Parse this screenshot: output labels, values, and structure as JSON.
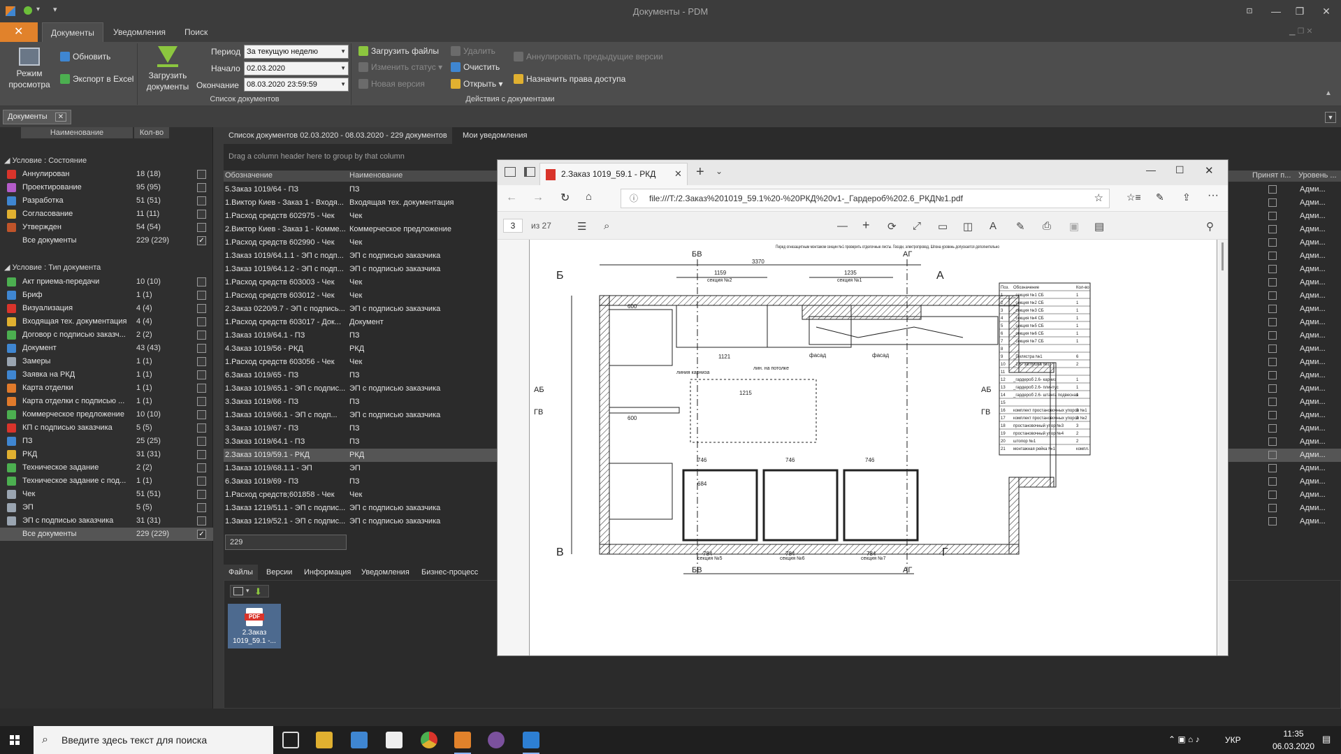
{
  "window": {
    "title": "Документы - PDM"
  },
  "ribbon": {
    "tabs": [
      "Документы",
      "Уведомления",
      "Поиск"
    ],
    "view_mode_label": "Режим просмотра",
    "refresh_label": "Обновить",
    "export_label": "Экспорт в Excel",
    "upload_docs_label": "Загрузить документы",
    "period_label": "Период",
    "period_value": "За текущую неделю",
    "start_label": "Начало",
    "start_value": "02.03.2020",
    "end_label": "Окончание",
    "end_value": "08.03.2020 23:59:59",
    "group_doclist": "Список документов",
    "upload_files": "Загрузить файлы",
    "change_status": "Изменить статус",
    "new_version": "Новая версия",
    "delete": "Удалить",
    "clear": "Очистить",
    "open": "Открыть",
    "annul_prev": "Аннулировать предыдущие версии",
    "assign_rights": "Назначить права доступа",
    "group_actions": "Действия с документами"
  },
  "doc_tab": {
    "label": "Документы"
  },
  "left": {
    "col_name": "Наименование",
    "col_count": "Кол-во",
    "group_state": "Условие : Состояние",
    "states": [
      {
        "name": "Аннулирован",
        "count": "18 (18)",
        "color": "#d9342b"
      },
      {
        "name": "Проектирование",
        "count": "95 (95)",
        "color": "#b45cc9"
      },
      {
        "name": "Разработка",
        "count": "51 (51)",
        "color": "#3f86d1"
      },
      {
        "name": "Согласование",
        "count": "11 (11)",
        "color": "#e0b030"
      },
      {
        "name": "Утвержден",
        "count": "54 (54)",
        "color": "#c0542a"
      },
      {
        "name": "Все документы",
        "count": "229 (229)",
        "color": ""
      }
    ],
    "group_type": "Условие : Тип документа",
    "types": [
      {
        "name": "Акт приема-передачи",
        "count": "10 (10)",
        "color": "#4caf50"
      },
      {
        "name": "Бриф",
        "count": "1 (1)",
        "color": "#3f86d1"
      },
      {
        "name": "Визуализация",
        "count": "4 (4)",
        "color": "#d9342b"
      },
      {
        "name": "Входящая тех. документация",
        "count": "4 (4)",
        "color": "#e0b030"
      },
      {
        "name": "Договор с подписью заказч...",
        "count": "2 (2)",
        "color": "#4caf50"
      },
      {
        "name": "Документ",
        "count": "43 (43)",
        "color": "#3f86d1"
      },
      {
        "name": "Замеры",
        "count": "1 (1)",
        "color": "#9aa5b1"
      },
      {
        "name": "Заявка на РКД",
        "count": "1 (1)",
        "color": "#3f86d1"
      },
      {
        "name": "Карта отделки",
        "count": "1 (1)",
        "color": "#e07a2b"
      },
      {
        "name": "Карта отделки с подписью ...",
        "count": "1 (1)",
        "color": "#e07a2b"
      },
      {
        "name": "Коммерческое предложение",
        "count": "10 (10)",
        "color": "#4caf50"
      },
      {
        "name": "КП с подписью заказчика",
        "count": "5 (5)",
        "color": "#d9342b"
      },
      {
        "name": "ПЗ",
        "count": "25 (25)",
        "color": "#3f86d1"
      },
      {
        "name": "РКД",
        "count": "31 (31)",
        "color": "#e0b030"
      },
      {
        "name": "Техническое задание",
        "count": "2 (2)",
        "color": "#4caf50"
      },
      {
        "name": "Техническое задание с под...",
        "count": "1 (1)",
        "color": "#4caf50"
      },
      {
        "name": "Чек",
        "count": "51 (51)",
        "color": "#9aa5b1"
      },
      {
        "name": "ЭП",
        "count": "5 (5)",
        "color": "#9aa5b1"
      },
      {
        "name": "ЭП с подписью заказчика",
        "count": "31 (31)",
        "color": "#9aa5b1"
      },
      {
        "name": "Все документы",
        "count": "229 (229)",
        "color": ""
      }
    ]
  },
  "center": {
    "tab_list": "Список документов 02.03.2020 - 08.03.2020 - 229 документов",
    "tab_notifications": "Мои уведомления",
    "drag_hint": "Drag a column header here to group by that column",
    "col_designation": "Обозначение",
    "col_name": "Наименование",
    "col_accepted": "Принят п...",
    "col_level": "Уровень ...",
    "admin": "Адми...",
    "rows": [
      [
        "5.Заказ 1019/64 - ПЗ",
        "ПЗ"
      ],
      [
        "1.Виктор Киев - Заказ 1 - Входя...",
        "Входящая тех. документация"
      ],
      [
        "1.Расход средств 602975 - Чек",
        "Чек"
      ],
      [
        "2.Виктор Киев - Заказ 1 - Комме...",
        "Коммерческое предложение"
      ],
      [
        "1.Расход средств 602990 - Чек",
        "Чек"
      ],
      [
        "1.Заказ 1019/64.1.1 - ЭП с подп...",
        "ЭП с подписью заказчика"
      ],
      [
        "1.Заказ 1019/64.1.2 - ЭП с подп...",
        "ЭП с подписью заказчика"
      ],
      [
        "1.Расход средств 603003 - Чек",
        "Чек"
      ],
      [
        "1.Расход средств 603012 - Чек",
        "Чек"
      ],
      [
        "2.Заказ 0220/9.7 - ЭП с подпись...",
        "ЭП с подписью заказчика"
      ],
      [
        "1.Расход средств 603017 - Док...",
        "Документ"
      ],
      [
        "1.Заказ 1019/64.1 - ПЗ",
        "ПЗ"
      ],
      [
        "4.Заказ 1019/56 - РКД",
        "РКД"
      ],
      [
        "1.Расход средств 603056 - Чек",
        "Чек"
      ],
      [
        "6.Заказ 1019/65 - ПЗ",
        "ПЗ"
      ],
      [
        "1.Заказ 1019/65.1 - ЭП с подпис...",
        "ЭП с подписью заказчика"
      ],
      [
        "3.Заказ 1019/66 - ПЗ",
        "ПЗ"
      ],
      [
        "1.Заказ 1019/66.1 - ЭП с подп...",
        "ЭП с подписью заказчика"
      ],
      [
        "3.Заказ 1019/67 - ПЗ",
        "ПЗ"
      ],
      [
        "3.Заказ 1019/64.1 - ПЗ",
        "ПЗ"
      ],
      [
        "2.Заказ 1019/59.1 - РКД",
        "РКД"
      ],
      [
        "1.Заказ 1019/68.1.1 - ЭП",
        "ЭП"
      ],
      [
        "6.Заказ 1019/69 - ПЗ",
        "ПЗ"
      ],
      [
        "1.Расход средств;601858 - Чек",
        "Чек"
      ],
      [
        "1.Заказ 1219/51.1 - ЭП с подпис...",
        "ЭП с подписью заказчика"
      ],
      [
        "1.Заказ 1219/52.1 - ЭП с подпис...",
        "ЭП с подписью заказчика"
      ]
    ],
    "selected_row": 20,
    "count": "229"
  },
  "bottom": {
    "tabs": [
      "Файлы",
      "Версии",
      "Информация",
      "Уведомления",
      "Бизнес-процесс"
    ],
    "file_name": "2.Заказ 1019_59.1 -...",
    "file_badge": "PDF"
  },
  "pdf": {
    "tab_title": "2.Заказ 1019_59.1 - РКД",
    "url": "file:///T:/2.Заказ%201019_59.1%20-%20РКД%20v1-_Гардероб%202.6_РКД№1.pdf",
    "page": "3",
    "page_of": "из 27",
    "drawing": {
      "corner_labels": [
        "Б",
        "А",
        "В",
        "Г"
      ],
      "section_labels": [
        "БВ",
        "АГ",
        "АБ",
        "ГВ"
      ],
      "dims_top": [
        "3370",
        "1159",
        "1235"
      ],
      "sections_top": [
        "секция №2",
        "секция №1"
      ],
      "sections_bottom": [
        "секция №5",
        "секция №6",
        "секция №7"
      ],
      "dims_bottom": [
        "784",
        "784",
        "784"
      ],
      "inner_dims": [
        "1121",
        "1215",
        "746",
        "746",
        "746",
        "600",
        "600",
        "684"
      ],
      "facade_labels": [
        "фасад",
        "фасад"
      ],
      "note_ceiling": "лин. на потолке",
      "note_cornice": "линия карниза",
      "note_top": "Перед огнезащитным монтажом секции №1 проверить отделочные листы. Гвозди, электропровод, Шпона уровень допускается дополнительно"
    },
    "spec_table": {
      "headers": [
        "Поз.",
        "Обозначение",
        "Кол-во"
      ],
      "rows": [
        [
          "1",
          "_секция №1 СБ",
          "1"
        ],
        [
          "2",
          "_секция №2 СБ",
          "1"
        ],
        [
          "3",
          "_секция №3 СБ",
          "1"
        ],
        [
          "4",
          "_секция №4 СБ",
          "1"
        ],
        [
          "5",
          "_секция №5 СБ",
          "1"
        ],
        [
          "6",
          "_секция №6 СБ",
          "1"
        ],
        [
          "7",
          "_секция №7 СБ",
          "1"
        ],
        [
          "8",
          "",
          ""
        ],
        [
          "9",
          "_Пилястра №1",
          "6"
        ],
        [
          "10",
          "_2.6- заглушка №1",
          "2"
        ],
        [
          "11",
          "",
          ""
        ],
        [
          "12",
          "_гардероб 2.6- карниз",
          "1"
        ],
        [
          "13",
          "_гардероб 2.6- плинтус",
          "1"
        ],
        [
          "14",
          "_гардероб 2.6- штанга подвесная",
          "1"
        ],
        [
          "15",
          "",
          ""
        ],
        [
          "16",
          "комплект простановочных упоров №1",
          "3"
        ],
        [
          "17",
          "комплект простановочных упоров №2",
          "2"
        ],
        [
          "18",
          "простановочный упор №3",
          "3"
        ],
        [
          "19",
          "простановочный упор №4",
          "2"
        ],
        [
          "20",
          "штопор №1",
          "2"
        ],
        [
          "21",
          "монтажная рейка №1",
          "компл."
        ]
      ]
    }
  },
  "taskbar": {
    "search_placeholder": "Введите здесь текст для поиска",
    "lang": "УКР",
    "time": "11:35",
    "date": "06.03.2020"
  }
}
